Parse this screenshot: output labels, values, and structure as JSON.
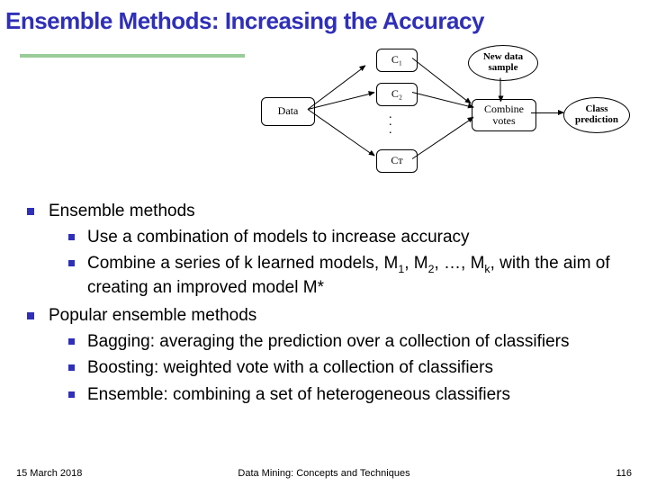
{
  "title": "Ensemble Methods: Increasing the Accuracy",
  "figure": {
    "data": "Data",
    "c1": "C₁",
    "c2": "C₂",
    "ct": "Cᴛ",
    "new_sample": "New data sample",
    "combine": "Combine votes",
    "prediction": "Class prediction"
  },
  "b1a": "Ensemble methods",
  "b2a": "Use a combination of models to increase accuracy",
  "b2b_pre": "Combine a series of k learned models, M",
  "b2b_s1": "1",
  "b2b_m1": ", M",
  "b2b_s2": "2",
  "b2b_m2": ", …, M",
  "b2b_s3": "k",
  "b2b_post": ", with the aim of creating an improved model M*",
  "b1b": "Popular ensemble methods",
  "b2c": "Bagging: averaging the prediction over a collection of classifiers",
  "b2d": "Boosting: weighted vote with a collection of classifiers",
  "b2e": "Ensemble: combining a set of heterogeneous classifiers",
  "footer": {
    "date": "15 March 2018",
    "mid": "Data Mining: Concepts and Techniques",
    "page": "116"
  }
}
